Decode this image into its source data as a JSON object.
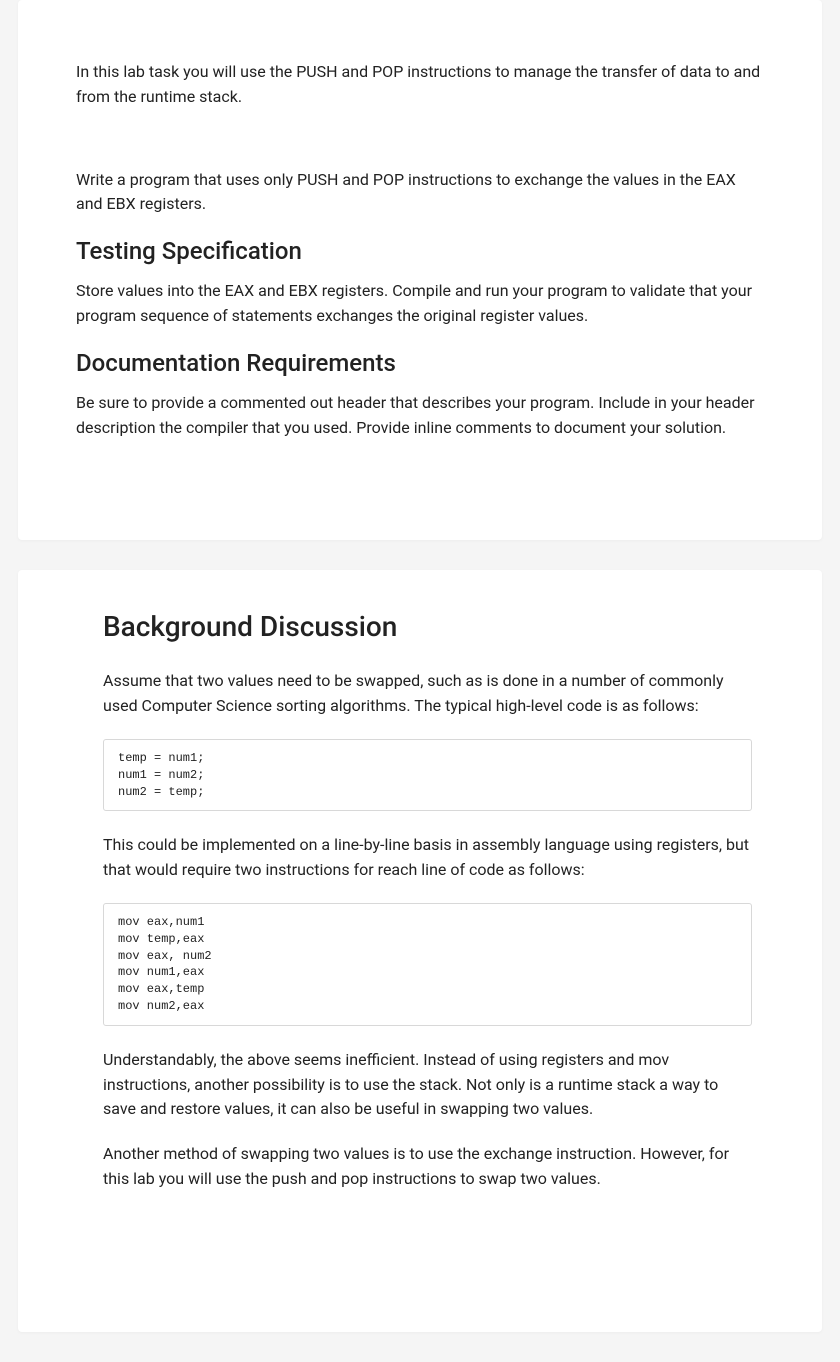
{
  "card1": {
    "intro": "In this lab task you will use the PUSH and POP instructions to manage the transfer of data to and from the runtime stack.",
    "write": "Write a program that uses only PUSH and POP instructions to exchange the values in the EAX and EBX registers.",
    "h_testing": "Testing Specification",
    "testing_body": "Store values into the EAX and EBX registers. Compile and run your program to validate that your program sequence of statements exchanges the original register values.",
    "h_doc": "Documentation Requirements",
    "doc_body": "Be sure to provide a commented out header that describes your program. Include in your header description the compiler that you used.  Provide inline comments to document your solution."
  },
  "card2": {
    "title": "Background Discussion",
    "p1": "Assume that two values need to be swapped, such as is done in a number of commonly  used Computer Science sorting algorithms.   The typical high-level code is as follows:",
    "code1": "temp = num1;\nnum1 = num2;\nnum2 = temp;",
    "p2": "This could be implemented on a line-by-line basis in assembly language using registers, but that would require two instructions for reach line of code as follows:",
    "code2": "mov eax,num1\nmov temp,eax\nmov eax, num2\nmov num1,eax\nmov eax,temp\nmov num2,eax",
    "p3": "Understandably, the above seems inefficient.  Instead of using registers and mov instructions, another possibility is to use the stack.  Not only is a runtime stack a way to save and restore values, it can also be useful in swapping two values.",
    "p4": "Another method of swapping two values is to use the exchange instruction.  However, for this lab you will use the push and pop instructions to swap two values."
  }
}
